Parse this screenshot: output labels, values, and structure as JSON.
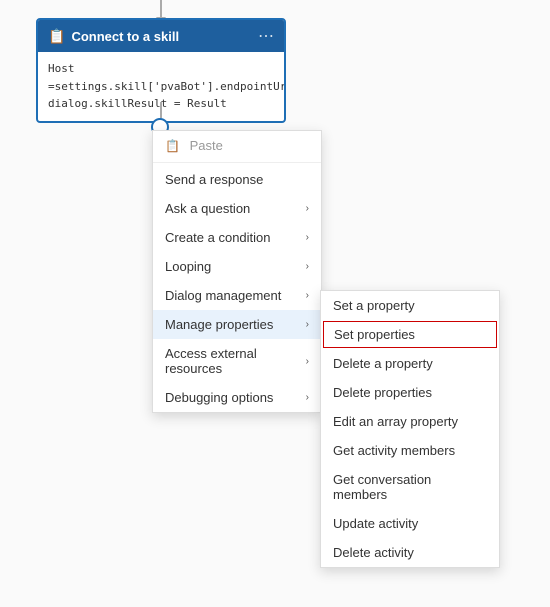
{
  "node": {
    "title": "Connect to a skill",
    "line1": "Host =settings.skill['pvaBot'].endpointUrl",
    "line2": "dialog.skillResult = Result"
  },
  "menu": {
    "paste_label": "Paste",
    "items": [
      {
        "label": "Send a response",
        "has_submenu": false
      },
      {
        "label": "Ask a question",
        "has_submenu": true
      },
      {
        "label": "Create a condition",
        "has_submenu": true
      },
      {
        "label": "Looping",
        "has_submenu": true
      },
      {
        "label": "Dialog management",
        "has_submenu": true
      },
      {
        "label": "Manage properties",
        "has_submenu": true,
        "active": true
      },
      {
        "label": "Access external resources",
        "has_submenu": true
      },
      {
        "label": "Debugging options",
        "has_submenu": true
      }
    ]
  },
  "submenu": {
    "items": [
      {
        "label": "Set a property",
        "highlighted": false
      },
      {
        "label": "Set properties",
        "highlighted": true
      },
      {
        "label": "Delete a property",
        "highlighted": false
      },
      {
        "label": "Delete properties",
        "highlighted": false
      },
      {
        "label": "Edit an array property",
        "highlighted": false
      },
      {
        "label": "Get activity members",
        "highlighted": false
      },
      {
        "label": "Get conversation members",
        "highlighted": false
      },
      {
        "label": "Update activity",
        "highlighted": false
      },
      {
        "label": "Delete activity",
        "highlighted": false
      }
    ]
  }
}
